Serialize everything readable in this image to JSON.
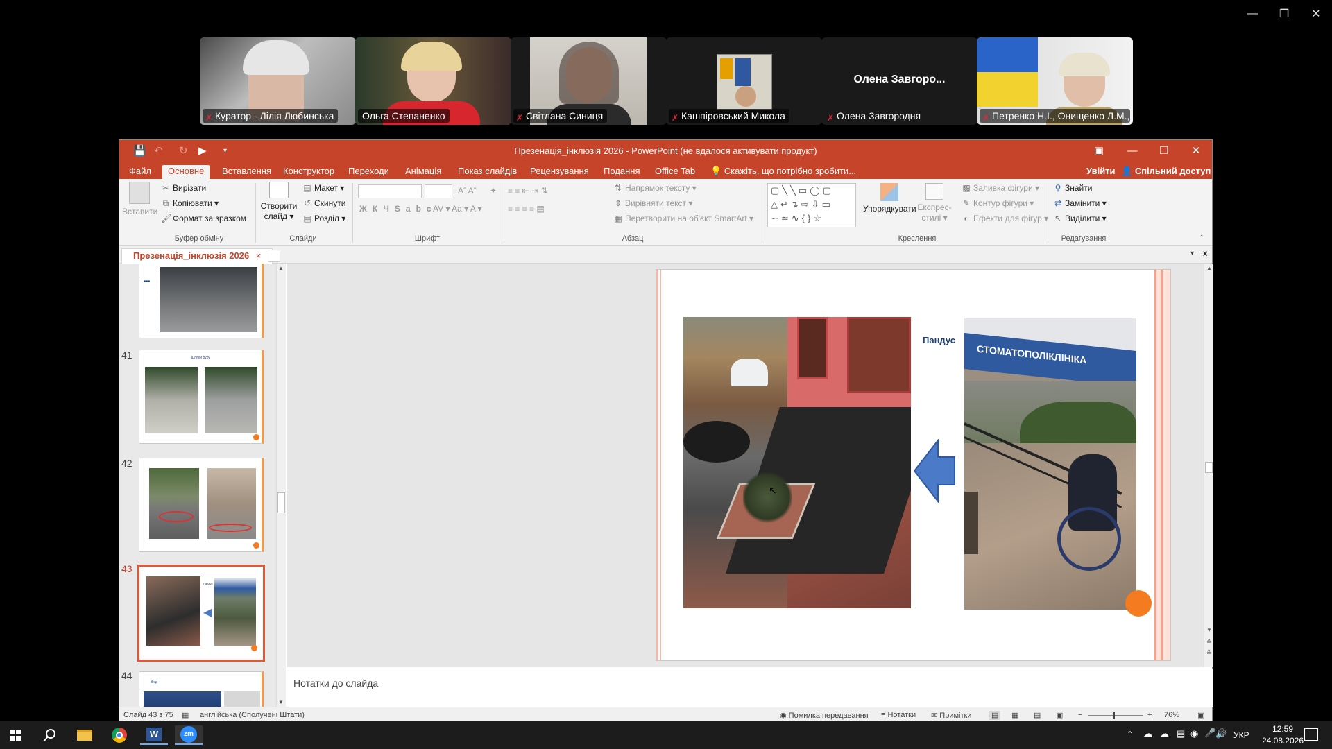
{
  "zoom_window": {
    "participants": [
      {
        "name": "Куратор - Лілія Любинська",
        "muted": true,
        "active": false
      },
      {
        "name": "Ольга Степаненко",
        "muted": false,
        "active": true
      },
      {
        "name": "Світлана Синиця",
        "muted": true,
        "active": false
      },
      {
        "name": "Кашпіровський Микола",
        "muted": true,
        "active": false
      },
      {
        "name": "Олена Завгородня",
        "muted": true,
        "active": false,
        "video_off_label": "Олена  Завгоро..."
      },
      {
        "name": "Петренко Н.І., Онищенко Л.М., ...",
        "muted": true,
        "active": false
      }
    ]
  },
  "app": {
    "title": "Презенація_інклюзія 2026 - PowerPoint (не вдалося активувати продукт)",
    "accent": "#c5442a"
  },
  "tabs": [
    "Файл",
    "Основне",
    "Вставлення",
    "Конструктор",
    "Переходи",
    "Анімація",
    "Показ слайдів",
    "Рецензування",
    "Подання",
    "Office Tab"
  ],
  "selected_tab": "Основне",
  "tellme": "Скажіть, що потрібно зробити...",
  "signin": "Увійти",
  "share": "Спільний доступ",
  "ribbon": {
    "clipboard": {
      "paste": "Вставити",
      "cut": "Вирізати",
      "copy": "Копіювати",
      "format": "Формат за зразком",
      "group": "Буфер обміну"
    },
    "slides": {
      "new": "Створити",
      "new2": "слайд",
      "layout": "Макет",
      "reset": "Скинути",
      "section": "Розділ",
      "group": "Слайди"
    },
    "font": {
      "group": "Шрифт"
    },
    "paragraph": {
      "direction": "Напрямок тексту",
      "align": "Вирівняти текст",
      "smartart": "Перетворити на об'єкт SmartArt",
      "group": "Абзац"
    },
    "drawing": {
      "arrange": "Упорядкувати",
      "quick1": "Експрес-",
      "quick2": "стилі",
      "fill": "Заливка фігури",
      "outline": "Контур фігури",
      "effects": "Ефекти для фігур",
      "group": "Креслення"
    },
    "editing": {
      "find": "Знайти",
      "replace": "Замінити",
      "select": "Виділити",
      "group": "Редагування"
    }
  },
  "doc_tab": "Презенація_інклюзія 2026",
  "thumbnails": [
    {
      "num": "",
      "caption": ""
    },
    {
      "num": "41",
      "caption": "Шляхи руху"
    },
    {
      "num": "42",
      "caption": ""
    },
    {
      "num": "43",
      "caption": "Пандус"
    },
    {
      "num": "44",
      "caption": "Вхід"
    }
  ],
  "slide": {
    "label": "Пандус",
    "sign_text": "СТОМАТОПОЛІКЛІНІКА"
  },
  "notes_placeholder": "Нотатки до слайда",
  "status": {
    "slide": "Слайд 43 з 75",
    "language": "англійська (Сполучені Штати)",
    "transmit": "Помилка передавання",
    "notes": "Нотатки",
    "comments": "Примітки",
    "zoom": "76%"
  },
  "taskbar": {
    "lang": "УКР",
    "time": "12:59",
    "date": "24.08.2026"
  }
}
